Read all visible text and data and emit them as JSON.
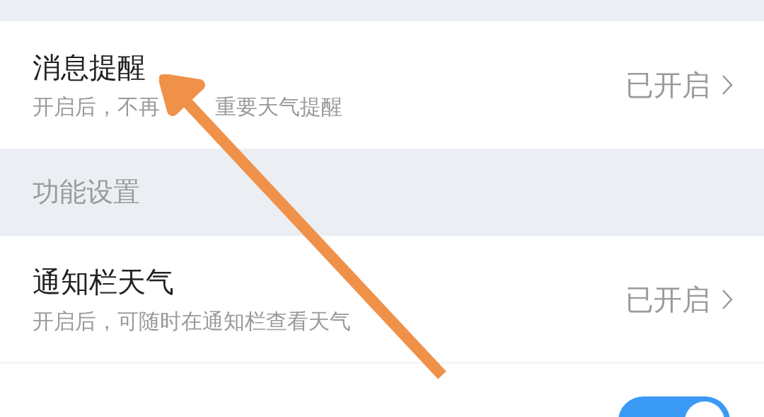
{
  "top_rows": [
    {
      "kind": "link",
      "title": "消息提醒",
      "description_parts": [
        "开启后，不再",
        "重要天气提醒"
      ],
      "status": "已开启"
    }
  ],
  "section_header": "功能设置",
  "rows": [
    {
      "kind": "link",
      "title": "通知栏天气",
      "description": "开启后，可随时在通知栏查看天气",
      "status": "已开启"
    },
    {
      "kind": "toggle",
      "on": true
    }
  ]
}
